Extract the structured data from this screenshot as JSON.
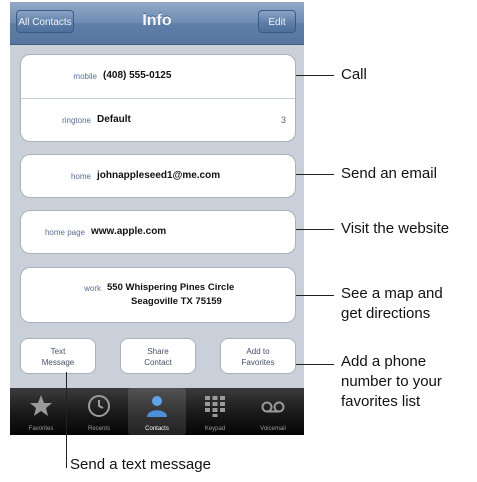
{
  "navbar": {
    "back_label": "All Contacts",
    "title": "Info",
    "edit_label": "Edit"
  },
  "phone_card": {
    "label": "mobile",
    "value": "(408) 555-0125"
  },
  "ringtone_row": {
    "label": "ringtone",
    "value": "Default",
    "count": "3"
  },
  "email_card": {
    "label": "home",
    "value": "johnappleseed1@me.com"
  },
  "web_card": {
    "label": "home page",
    "value": "www.apple.com"
  },
  "address_card": {
    "label": "work",
    "line1": "550 Whispering Pines Circle",
    "line2": "Seagoville TX 75159"
  },
  "actions": {
    "text_message": [
      "Text",
      "Message"
    ],
    "share_contact": [
      "Share",
      "Contact"
    ],
    "add_favorites": [
      "Add to",
      "Favorites"
    ]
  },
  "tabbar": [
    {
      "label": "Favorites",
      "icon": "star-icon",
      "active": false
    },
    {
      "label": "Recents",
      "icon": "clock-icon",
      "active": false
    },
    {
      "label": "Contacts",
      "icon": "person-icon",
      "active": true
    },
    {
      "label": "Keypad",
      "icon": "keypad-icon",
      "active": false
    },
    {
      "label": "Voicemail",
      "icon": "voicemail-icon",
      "active": false
    }
  ],
  "callouts": {
    "call": "Call",
    "email": "Send an email",
    "website": "Visit the website",
    "map": [
      "See a map and",
      "get directions"
    ],
    "favorites": [
      "Add a phone",
      "number to your",
      "favorites list"
    ],
    "text": "Send a text message"
  }
}
